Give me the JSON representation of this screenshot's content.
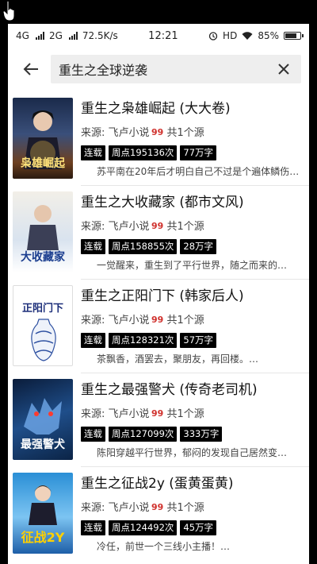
{
  "status": {
    "network_left": "4G",
    "network_mid": "2G",
    "speed": "72.5K/s",
    "time": "12:21",
    "hd": "HD",
    "battery": "85%",
    "battery_level": 0.85
  },
  "search": {
    "query": "重生之全球逆袭"
  },
  "colors": {
    "tag_bg": "#000000",
    "source_logo": "#d0312d",
    "screen_bg": "#ffffff"
  },
  "books": [
    {
      "title": "重生之枭雄崛起 (大大卷)",
      "source_label": "来源: 飞卢小说",
      "source_count": "共1个源",
      "status": "连载",
      "clicks": "周点195136次",
      "words": "77万字",
      "desc": "苏平南在20年后才明白自己不过是个遍体鳞伤…",
      "cover_text": "枭雄崛起"
    },
    {
      "title": "重生之大收藏家 (都市文风)",
      "source_label": "来源: 飞卢小说",
      "source_count": "共1个源",
      "status": "连载",
      "clicks": "周点158855次",
      "words": "28万字",
      "desc": "一觉醒来，重生到了平行世界，随之而来的…",
      "cover_text": "大收藏家"
    },
    {
      "title": "重生之正阳门下 (韩家后人)",
      "source_label": "来源: 飞卢小说",
      "source_count": "共1个源",
      "status": "连载",
      "clicks": "周点128321次",
      "words": "57万字",
      "desc": "茶飘香，酒罢去，聚朋友，再回楼。…",
      "cover_text": "正阳门下"
    },
    {
      "title": "重生之最强警犬 (传奇老司机)",
      "source_label": "来源: 飞卢小说",
      "source_count": "共1个源",
      "status": "连载",
      "clicks": "周点127099次",
      "words": "333万字",
      "desc": "陈阳穿越平行世界，郁闷的发现自己居然变…",
      "cover_text": "最强警犬"
    },
    {
      "title": "重生之征战2y (蛋黄蛋黄)",
      "source_label": "来源: 飞卢小说",
      "source_count": "共1个源",
      "status": "连载",
      "clicks": "周点124492次",
      "words": "45万字",
      "desc": "冷任，前世一个三线小主播！…",
      "cover_text": "征战2Y"
    }
  ]
}
